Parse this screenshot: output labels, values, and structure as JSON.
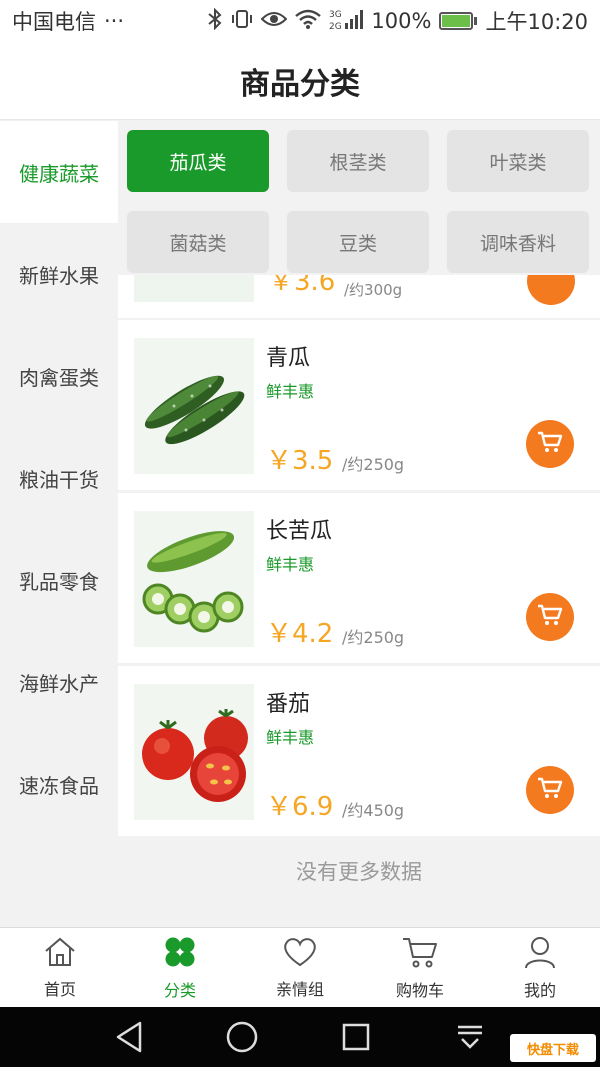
{
  "status_bar": {
    "carrier": "中国电信",
    "dots": "···",
    "network": "3G 2G",
    "battery": "100%",
    "time": "上午10:20"
  },
  "header": {
    "title": "商品分类"
  },
  "sidebar": {
    "items": [
      {
        "label": "健康蔬菜",
        "active": true
      },
      {
        "label": "新鲜水果",
        "active": false
      },
      {
        "label": "肉禽蛋类",
        "active": false
      },
      {
        "label": "粮油干货",
        "active": false
      },
      {
        "label": "乳品零食",
        "active": false
      },
      {
        "label": "海鲜水产",
        "active": false
      },
      {
        "label": "速冻食品",
        "active": false
      }
    ]
  },
  "chips": [
    {
      "label": "茄瓜类",
      "active": true
    },
    {
      "label": "根茎类",
      "active": false
    },
    {
      "label": "叶菜类",
      "active": false
    },
    {
      "label": "菌菇类",
      "active": false
    },
    {
      "label": "豆类",
      "active": false
    },
    {
      "label": "调味香料",
      "active": false
    }
  ],
  "partial_item": {
    "price": "￥3.6",
    "weight": "/约300g"
  },
  "products": [
    {
      "name": "青瓜",
      "tag": "鲜丰惠",
      "price": "￥3.5",
      "weight": "/约250g",
      "icon": "cucumber-image"
    },
    {
      "name": "长苦瓜",
      "tag": "鲜丰惠",
      "price": "￥4.2",
      "weight": "/约250g",
      "icon": "bitter-melon-image"
    },
    {
      "name": "番茄",
      "tag": "鲜丰惠",
      "price": "￥6.9",
      "weight": "/约450g",
      "icon": "tomato-image"
    }
  ],
  "no_more": "没有更多数据",
  "bottom_nav": [
    {
      "label": "首页",
      "icon": "home-icon"
    },
    {
      "label": "分类",
      "icon": "category-icon",
      "active": true
    },
    {
      "label": "亲情组",
      "icon": "heart-icon"
    },
    {
      "label": "购物车",
      "icon": "cart-icon"
    },
    {
      "label": "我的",
      "icon": "user-icon"
    }
  ],
  "watermark": "快盘下载",
  "colors": {
    "accent": "#1a9a2a",
    "price": "#f5a623",
    "cart": "#f47a20"
  }
}
